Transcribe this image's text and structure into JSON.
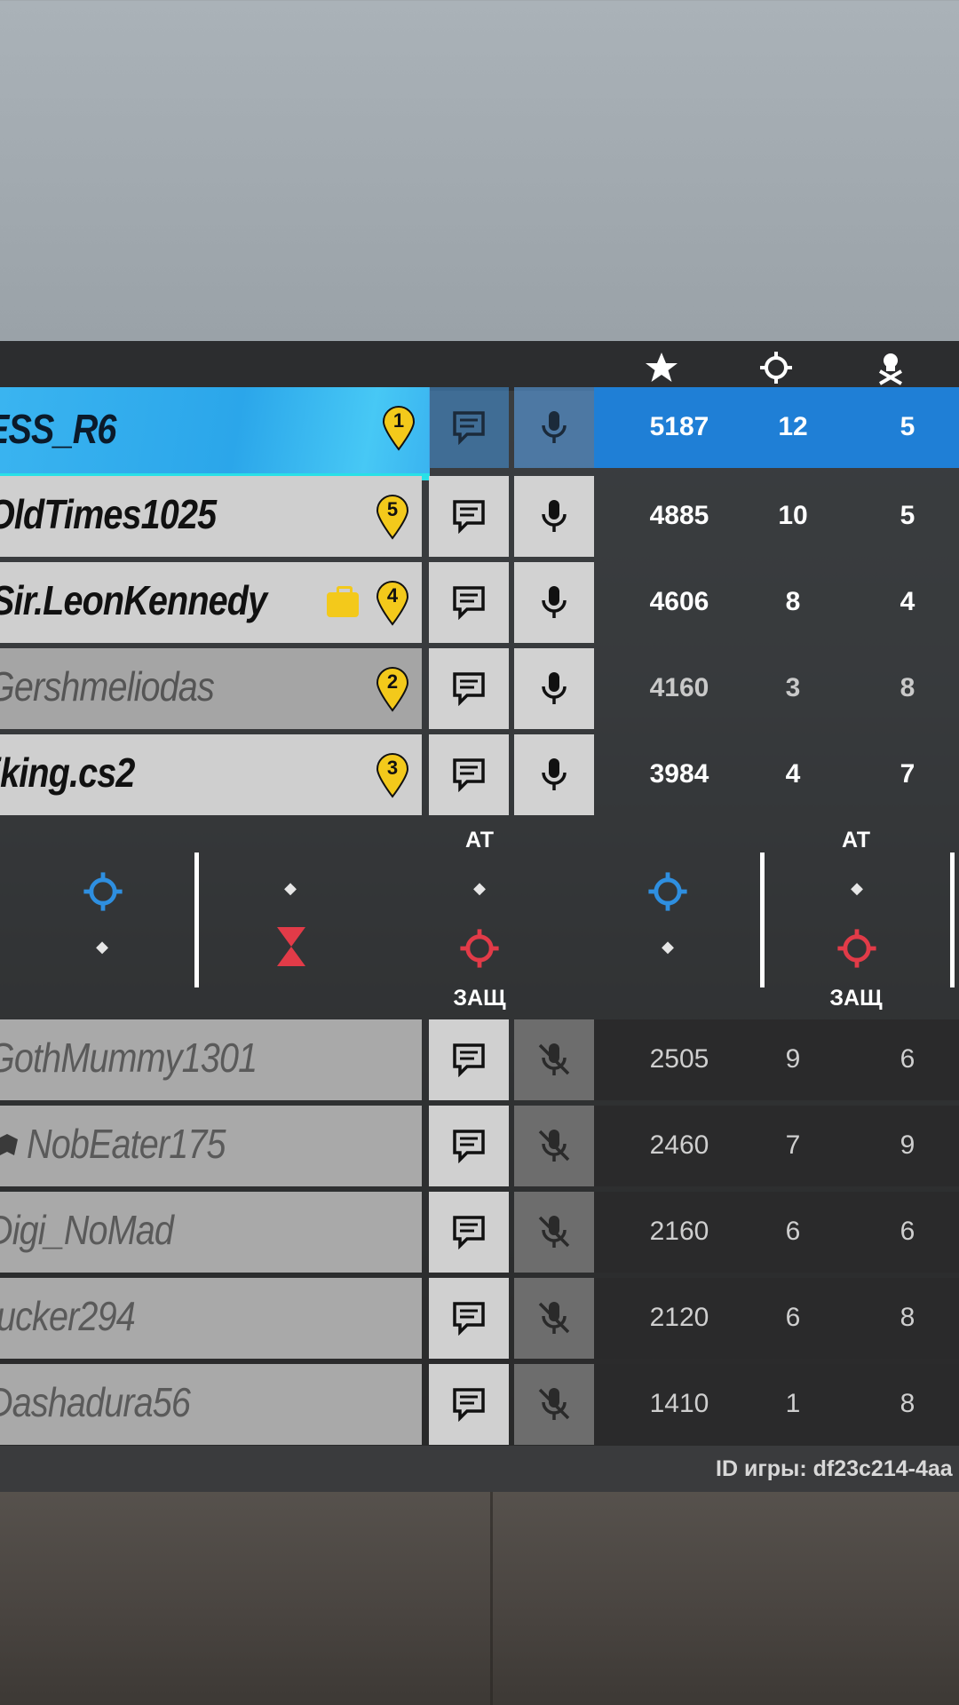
{
  "header_icons": [
    "star-icon",
    "crosshair-icon",
    "skull-icon"
  ],
  "team_top": [
    {
      "name": "ESS_R6",
      "rank": "1",
      "score": "5187",
      "kills": "12",
      "deaths": "5"
    },
    {
      "name": "OldTimes1025",
      "rank": "5",
      "score": "4885",
      "kills": "10",
      "deaths": "5"
    },
    {
      "name": "Sir.LeonKennedy",
      "rank": "4",
      "score": "4606",
      "kills": "8",
      "deaths": "4"
    },
    {
      "name": "Gershmeliodas",
      "rank": "2",
      "score": "4160",
      "kills": "3",
      "deaths": "8"
    },
    {
      "name": "iking.cs2",
      "rank": "3",
      "score": "3984",
      "kills": "4",
      "deaths": "7"
    }
  ],
  "round_info": {
    "attack_label": "АТ",
    "defense_label": "ЗАЩ",
    "attack_label_2": "АТ",
    "defense_label_2": "ЗАЩ"
  },
  "team_bottom": [
    {
      "name": "GothMummy1301",
      "score": "2505",
      "kills": "9",
      "deaths": "6"
    },
    {
      "name": "NobEater175",
      "score": "2460",
      "kills": "7",
      "deaths": "9"
    },
    {
      "name": "Digi_NoMad",
      "score": "2160",
      "kills": "6",
      "deaths": "6"
    },
    {
      "name": "ucker294",
      "score": "2120",
      "kills": "6",
      "deaths": "8"
    },
    {
      "name": "Dashadura56",
      "score": "1410",
      "kills": "1",
      "deaths": "8"
    }
  ],
  "footer": {
    "game_id": "ID игры: df23c214-4aa"
  },
  "colors": {
    "self_highlight": "#2ba6ea",
    "attack": "#2e8fe0",
    "defense": "#e23b48",
    "rank_pin": "#f3c91b"
  }
}
